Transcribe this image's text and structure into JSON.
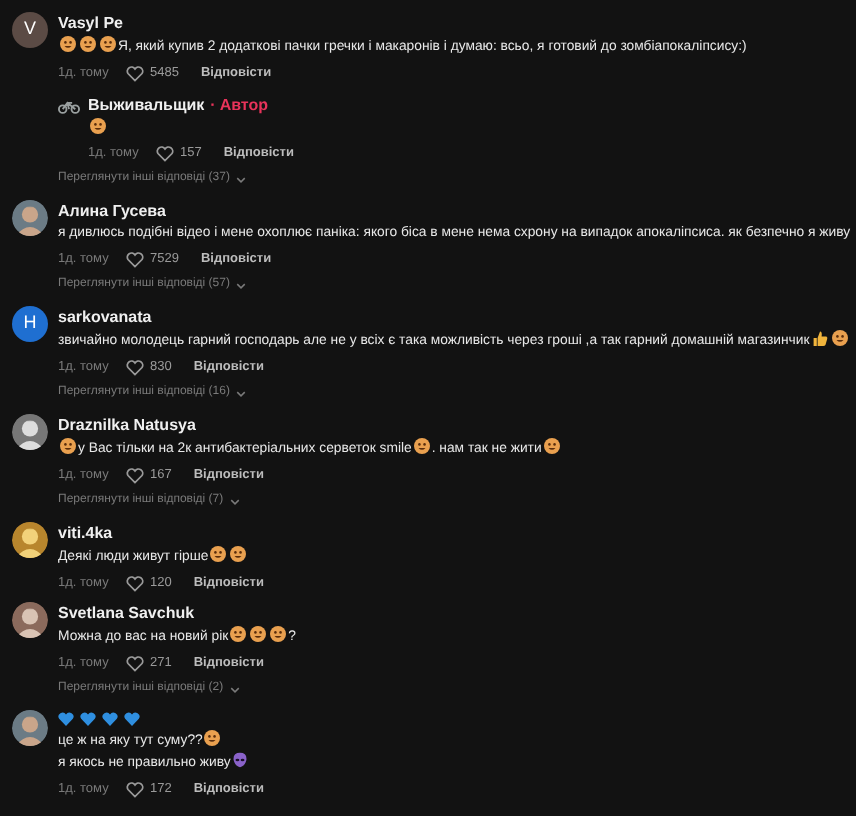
{
  "comments": [
    {
      "avatar": {
        "kind": "letter",
        "letter": "V",
        "color": "#5b4b45"
      },
      "author": "Vasyl Pe",
      "lines": [
        [
          {
            "kind": "face"
          },
          {
            "kind": "face"
          },
          {
            "kind": "face"
          },
          {
            "kind": "text",
            "text": "Я, який купив 2 додаткові пачки гречки і макаронів і думаю: всьо, я готовий до зомбіапокаліпсису:)"
          }
        ]
      ],
      "time": "1д. тому",
      "likes": "5485",
      "reply_label": "Відповісти",
      "replies": [
        {
          "author": "Выживальщик",
          "separator": "·",
          "badge": "Автор",
          "lines": [
            [
              {
                "kind": "face"
              }
            ]
          ],
          "time": "1д. тому",
          "likes": "157",
          "reply_label": "Відповісти"
        }
      ],
      "view_more": "Переглянути інші відповіді (37)"
    },
    {
      "avatar": {
        "kind": "picture"
      },
      "author": "Алина Гусева",
      "lines": [
        [
          {
            "kind": "text",
            "text": "я дивлюсь подібні відео і мене охоплює паніка: якого біса в мене нема схрону на випадок апокаліпсиса. як безпечно я живу"
          }
        ]
      ],
      "time": "1д. тому",
      "likes": "7529",
      "reply_label": "Відповісти",
      "view_more": "Переглянути інші відповіді (57)"
    },
    {
      "avatar": {
        "kind": "letter",
        "letter": "H",
        "color": "#1f6fd1"
      },
      "author": "sarkovanata",
      "lines": [
        [
          {
            "kind": "text",
            "text": "звичайно молодець гарний господарь але не у всіх є така можливість через гроші ,а так гарний домашній магазинчик"
          },
          {
            "kind": "thumb"
          },
          {
            "kind": "face"
          }
        ]
      ],
      "time": "1д. тому",
      "likes": "830",
      "reply_label": "Відповісти",
      "view_more": "Переглянути інші відповіді (16)"
    },
    {
      "avatar": {
        "kind": "picture"
      },
      "author": "Draznilka Natusya",
      "lines": [
        [
          {
            "kind": "face"
          },
          {
            "kind": "text",
            "text": "у Вас тільки на 2к антибактеріальних серветок smile"
          },
          {
            "kind": "face"
          },
          {
            "kind": "text",
            "text": ". нам так не жити"
          },
          {
            "kind": "face"
          }
        ]
      ],
      "time": "1д. тому",
      "likes": "167",
      "reply_label": "Відповісти",
      "view_more": "Переглянути інші відповіді (7)"
    },
    {
      "avatar": {
        "kind": "picture"
      },
      "author": "viti.4ka",
      "lines": [
        [
          {
            "kind": "text",
            "text": "Деякі люди живут гірше"
          },
          {
            "kind": "face"
          },
          {
            "kind": "face"
          }
        ]
      ],
      "time": "1д. тому",
      "likes": "120",
      "reply_label": "Відповісти"
    },
    {
      "avatar": {
        "kind": "picture"
      },
      "author": "Svetlana Savchuk",
      "lines": [
        [
          {
            "kind": "text",
            "text": "Можна до вас на новий рік"
          },
          {
            "kind": "face"
          },
          {
            "kind": "face"
          },
          {
            "kind": "face"
          },
          {
            "kind": "text",
            "text": "?"
          }
        ]
      ],
      "time": "1д. тому",
      "likes": "271",
      "reply_label": "Відповісти",
      "view_more": "Переглянути інші відповіді (2)"
    },
    {
      "avatar": {
        "kind": "picture"
      },
      "lines": [
        [
          {
            "kind": "heart"
          },
          {
            "kind": "heart"
          },
          {
            "kind": "heart"
          },
          {
            "kind": "heart"
          }
        ],
        [
          {
            "kind": "text",
            "text": "це ж на яку тут суму??"
          },
          {
            "kind": "face"
          }
        ],
        [
          {
            "kind": "text",
            "text": "я якось не правильно живу"
          },
          {
            "kind": "alien"
          }
        ]
      ],
      "time": "1д. тому",
      "likes": "172",
      "reply_label": "Відповісти"
    }
  ]
}
